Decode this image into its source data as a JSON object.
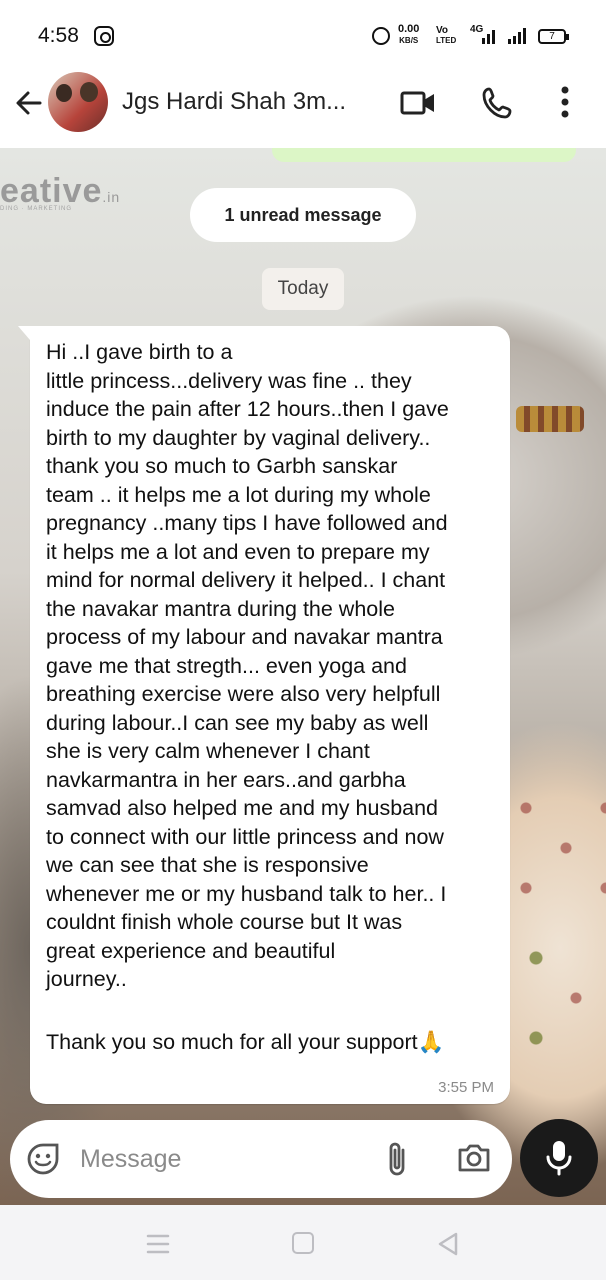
{
  "status_bar": {
    "time": "4:58",
    "speed_value": "0.00",
    "speed_unit": "KB/S",
    "volte_top": "Vo",
    "volte_bottom": "LTED",
    "network": "4G",
    "battery": "7",
    "icons": [
      "instagram-icon",
      "alarm-icon",
      "signal-icon",
      "battery-icon"
    ]
  },
  "header": {
    "contact_name": "Jgs Hardi Shah 3m...",
    "icons": [
      "back-arrow-icon",
      "avatar",
      "video-call-icon",
      "phone-icon",
      "more-vert-icon"
    ]
  },
  "wallpaper": {
    "visible_text": "eative",
    "visible_text_suffix": ".in",
    "visible_subtext": "DING · MARKETING"
  },
  "chat": {
    "unread_label": "1 unread message",
    "date_label": "Today",
    "message": {
      "text": "Hi ..I gave birth to a\nlittle princess...delivery was fine .. they\ninduce the pain after 12 hours..then I gave\nbirth to my daughter by vaginal delivery..\nthank you so much to Garbh sanskar\nteam .. it helps me a lot during my whole\npregnancy ..many tips I have followed and\nit helps me a lot and even to prepare my\nmind for normal delivery it helped.. I chant\nthe navakar mantra during the whole\nprocess of my labour and navakar mantra\ngave me that stregth... even yoga and\nbreathing exercise were also very helpfull\nduring labour..I can see my baby as well\nshe is very calm whenever I chant\nnavkarmantra in her ears..and garbha\nsamvad also helped me and my husband\nto connect with our little princess and now\nwe can see that she is responsive\nwhenever me or my husband talk to her.. I\ncouldnt finish whole course but It was\ngreat experience and beautiful\njourney..",
      "closing": "Thank you so much for all your support🙏",
      "time": "3:55 PM"
    }
  },
  "composer": {
    "placeholder": "Message",
    "icons": [
      "emoji-icon",
      "attach-icon",
      "camera-icon",
      "mic-icon"
    ]
  },
  "nav_bar": {
    "icons": [
      "recent-apps-icon",
      "home-icon",
      "back-icon"
    ]
  },
  "colors": {
    "bubble": "#ffffff",
    "mic_button": "#1a1a1a",
    "nav_bar": "#f4f4f6",
    "pill": "#ffffff"
  }
}
